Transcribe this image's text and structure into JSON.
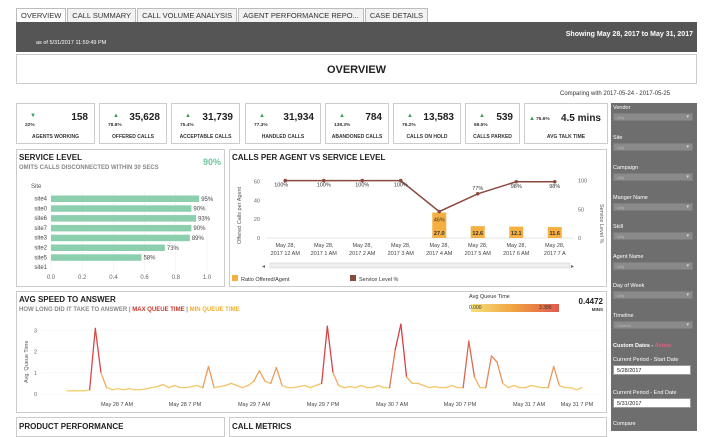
{
  "tabs": [
    "OVERVIEW",
    "CALL SUMMARY",
    "CALL VOLUME ANALYSIS",
    "AGENT PERFORMANCE REPO...",
    "CASE DETAILS"
  ],
  "header": {
    "as_of": "as of 5/31/2017 11:59:49 PM",
    "range": "Showing May 28, 2017 to May 31, 2017"
  },
  "title": "OVERVIEW",
  "comparing": "Comparing with 2017-05-24 - 2017-05-25",
  "kpis": [
    {
      "pct": "22%",
      "value": "158",
      "label": "AGENTS  WORKING",
      "direction": "down"
    },
    {
      "pct": "78.8%",
      "value": "35,628",
      "label": "OFFERED CALLS",
      "direction": "up"
    },
    {
      "pct": "75.4%",
      "value": "31,739",
      "label": "ACCEPTABLE CALLS",
      "direction": "up"
    },
    {
      "pct": "77.3%",
      "value": "31,934",
      "label": "HANDLED CALLS",
      "direction": "up"
    },
    {
      "pct": "138.3%",
      "value": "784",
      "label": "ABANDONED CALLS",
      "direction": "up"
    },
    {
      "pct": "76.2%",
      "value": "13,583",
      "label": "CALLS ON HOLD",
      "direction": "up"
    },
    {
      "pct": "69.5%",
      "value": "539",
      "label": "CALLS PARKED",
      "direction": "up"
    },
    {
      "pct": "76.6%",
      "value": "4.5 mins",
      "label": "AVG TALK TIME",
      "direction": "up"
    }
  ],
  "colors": {
    "up": "#3a9a5a",
    "bar_green": "#8ccfae",
    "line_brown": "#8b4a3e",
    "bar_orange": "#f5b041",
    "queue_max": "#c0392b",
    "queue_min": "#f0b030"
  },
  "sidebar": {
    "filters": [
      {
        "label": "Vendor",
        "value": "(All)"
      },
      {
        "label": "Site",
        "value": "(All)"
      },
      {
        "label": "Campaign",
        "value": "(All)"
      },
      {
        "label": "Manger Name",
        "value": "(All)"
      },
      {
        "label": "Skill",
        "value": "(All)"
      },
      {
        "label": "Agent Name",
        "value": "(All)"
      },
      {
        "label": "Day of Week",
        "value": "(All)"
      },
      {
        "label": "Timeline",
        "value": "Custom"
      }
    ],
    "custom_dates_label": "Custom Dates -",
    "custom_dates_status": "Active",
    "start_label": "Current Period - Start Date",
    "start_value": "5/28/2017",
    "end_label": "Current Period - End Date",
    "end_value": "5/31/2017",
    "compare_label": "Compare"
  },
  "service_level": {
    "title": "SERVICE LEVEL",
    "subtitle": "OMITS CALLS DISCONNECTED WITHIN 30 SECS",
    "overall": "90%",
    "axis_label": "Site",
    "chart_data": {
      "type": "bar",
      "orientation": "horizontal",
      "categories": [
        "site4",
        "site0",
        "site6",
        "site7",
        "site3",
        "site2",
        "site5",
        "site1"
      ],
      "values": [
        0.95,
        0.9,
        0.93,
        0.9,
        0.89,
        0.73,
        0.58,
        null
      ],
      "labels": [
        "95%",
        "90%",
        "93%",
        "90%",
        "89%",
        "73%",
        "58%",
        ""
      ],
      "xlim": [
        0,
        1.0
      ],
      "ticks": [
        "0.0",
        "0.2",
        "0.4",
        "0.6",
        "0.8",
        "1.0"
      ]
    }
  },
  "calls_per_agent": {
    "title": "CALLS PER AGENT VS SERVICE LEVEL",
    "ylabel": "Offered Calls per Agent",
    "y2label": "Service Level %",
    "legend": [
      "Ratio Offered/Agent",
      "Service Level %"
    ],
    "chart_data": {
      "type": "bar",
      "x": [
        "May 28, 2017 12 AM",
        "May 28, 2017 1 AM",
        "May 28, 2017 2 AM",
        "May 28, 2017 3 AM",
        "May 28, 2017 4 AM",
        "May 28, 2017 5 AM",
        "May 28, 2017 6 AM",
        "May 28, 2017 7 A"
      ],
      "series": [
        {
          "name": "Ratio Offered/Agent",
          "values": [
            null,
            null,
            null,
            null,
            27.0,
            12.6,
            12.1,
            11.6
          ]
        },
        {
          "name": "Service Level %",
          "values": [
            100,
            100,
            100,
            100,
            46,
            77,
            98,
            98
          ]
        }
      ],
      "ylim": [
        0,
        70
      ],
      "yticks": [
        "0",
        "20",
        "40",
        "60"
      ],
      "y2ticks": [
        "0",
        "50",
        "100"
      ],
      "ratio_labels": [
        "",
        "",
        "",
        "",
        "27.0",
        "12.6",
        "12.1",
        "11.6"
      ],
      "sl_labels": [
        "100%",
        "100%",
        "100%",
        "100%",
        "46%",
        "77%",
        "98%",
        "98%"
      ]
    }
  },
  "avg_speed": {
    "title": "AVG SPEED TO ANSWER",
    "subtitle_a": "HOW LONG DID IT TAKE TO ANSWER |",
    "subtitle_b": "MAX QUEUE TIME",
    "subtitle_c": "|",
    "subtitle_d": "MIN QUEUE TIME",
    "legend_title": "Avg Queue Time",
    "legend_min": "0.000",
    "legend_max": "3.386",
    "value": "0.4472",
    "value_unit": "MINS",
    "ylabel": "Avg. Queue Time",
    "chart_data": {
      "type": "line",
      "x_labels": [
        "May 28 7 AM",
        "May 28 7 PM",
        "May 29 7 AM",
        "May 29 7 PM",
        "May 30 7 AM",
        "May 30 7 PM",
        "May 31 7 AM",
        "May 31 7 PM"
      ],
      "ylim": [
        0,
        3.4
      ],
      "yticks": [
        "0",
        "1",
        "2",
        "3"
      ],
      "values": [
        0.15,
        0.15,
        0.15,
        0.15,
        0.2,
        3.1,
        1.0,
        0.3,
        0.2,
        0.25,
        0.2,
        0.25,
        0.2,
        0.2,
        0.25,
        0.3,
        0.35,
        0.45,
        0.3,
        0.4,
        0.3,
        0.3,
        0.35,
        0.4,
        0.3,
        1.3,
        0.3,
        0.35,
        0.4,
        0.5,
        0.4,
        0.3,
        0.4,
        0.6,
        1.1,
        0.6,
        0.5,
        1.25,
        0.4,
        0.3,
        0.3,
        0.35,
        0.4,
        0.3,
        0.4,
        0.5,
        3.2,
        1.0,
        0.4,
        0.3,
        0.35,
        0.3,
        0.4,
        0.3,
        0.3,
        0.4,
        0.3,
        0.3,
        2.1,
        3.3,
        0.8,
        0.5,
        0.5,
        0.4,
        0.3,
        0.35,
        0.3,
        0.3,
        0.4,
        0.3,
        0.3,
        2.5,
        0.8,
        0.3,
        0.3,
        1.8,
        1.5,
        0.5,
        0.3,
        0.4,
        0.3,
        0.3,
        0.4,
        0.35,
        0.3,
        0.3,
        1.3,
        0.4,
        0.3,
        0.3,
        0.2,
        0.3
      ]
    }
  },
  "bottom": {
    "product": "PRODUCT PERFORMANCE",
    "call_metrics": "CALL METRICS"
  }
}
